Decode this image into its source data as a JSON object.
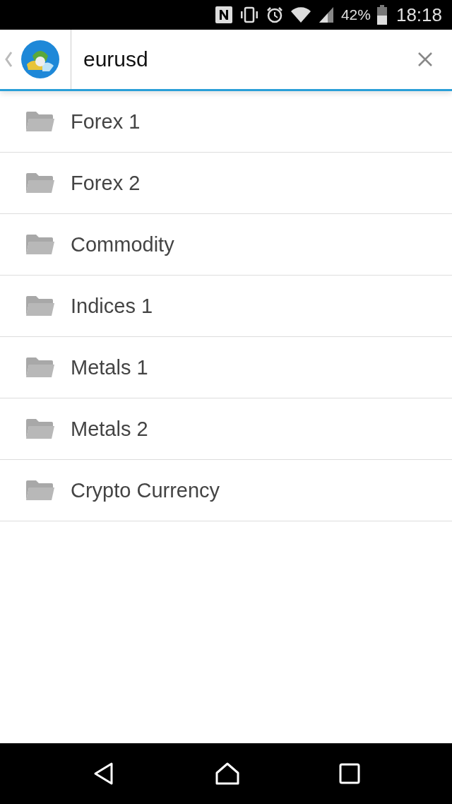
{
  "status_bar": {
    "battery": "42%",
    "time": "18:18"
  },
  "search": {
    "value": "eurusd"
  },
  "folders": [
    {
      "label": "Forex 1"
    },
    {
      "label": "Forex 2"
    },
    {
      "label": "Commodity"
    },
    {
      "label": "Indices 1"
    },
    {
      "label": "Metals 1"
    },
    {
      "label": "Metals 2"
    },
    {
      "label": "Crypto Currency"
    }
  ]
}
